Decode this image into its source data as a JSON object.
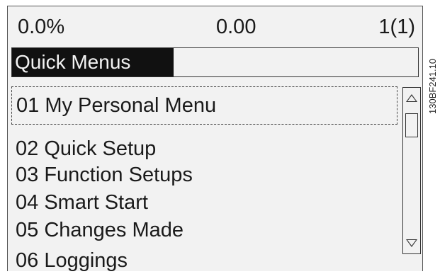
{
  "status": {
    "left": "0.0%",
    "middle": "0.00",
    "right": "1(1)"
  },
  "title": "Quick Menus",
  "menu": {
    "items": [
      {
        "label": "01  My Personal Menu",
        "selected": true
      },
      {
        "label": "02  Quick Setup",
        "selected": false
      },
      {
        "label": "03  Function Setups",
        "selected": false
      },
      {
        "label": "04  Smart Start",
        "selected": false
      },
      {
        "label": "05   Changes Made",
        "selected": false
      },
      {
        "label": "06  Loggings",
        "selected": false
      }
    ]
  },
  "scrollbar": {
    "up_icon": "triangle-up-icon",
    "down_icon": "triangle-down-icon"
  },
  "figure_code": "130BF241.10"
}
